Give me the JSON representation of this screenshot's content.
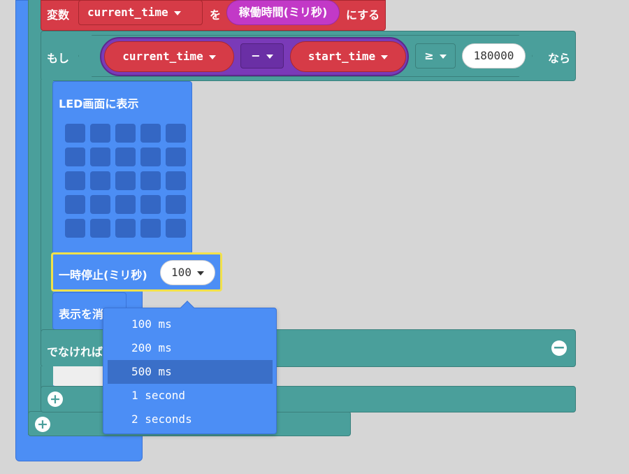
{
  "set_block": {
    "prefix": "変数",
    "var_name": "current_time",
    "particle": "を",
    "reporter": "稼働時間(ミリ秒)",
    "suffix": "にする"
  },
  "if_block": {
    "label": "もし",
    "left_var": "current_time",
    "operator": "−",
    "right_var": "start_time",
    "comparator": "≥",
    "value": "180000",
    "then_label": "なら"
  },
  "led_block": {
    "label": "LED画面に表示"
  },
  "pause_block": {
    "label": "一時停止(ミリ秒)",
    "value": "100"
  },
  "clear_block": {
    "label": "表示を消す"
  },
  "else_block": {
    "label": "でなければ"
  },
  "dropdown": {
    "items": [
      "100 ms",
      "200 ms",
      "500 ms",
      "1 second",
      "2 seconds"
    ],
    "highlighted": "500 ms"
  },
  "colors": {
    "variables": "#d63b47",
    "logic": "#4a9f9b",
    "basic": "#4c8ef5",
    "math": "#7a3ab8",
    "input": "#c239c7"
  }
}
